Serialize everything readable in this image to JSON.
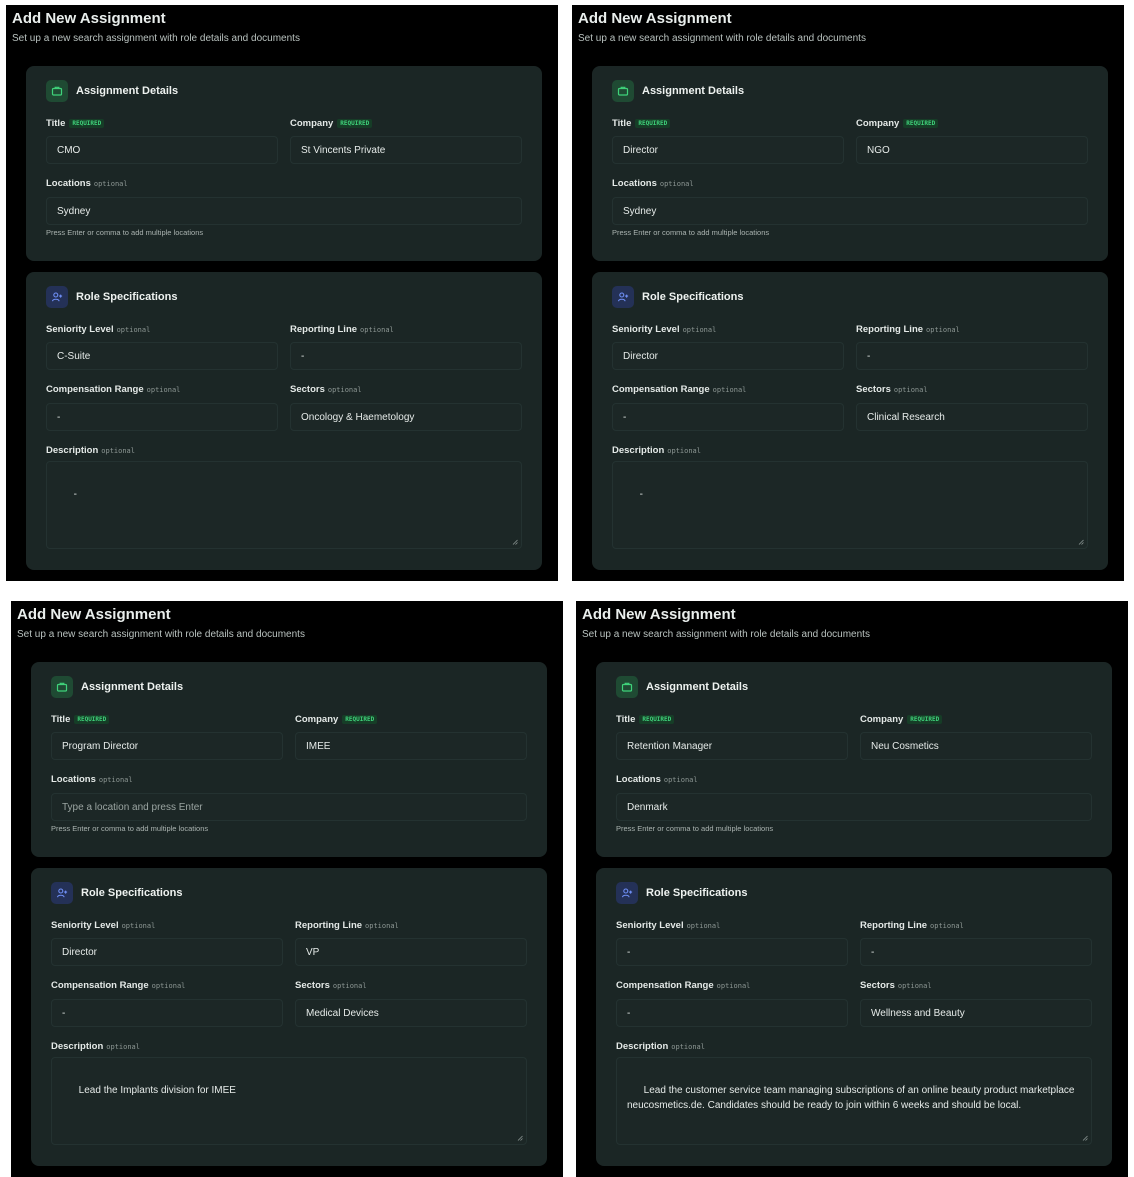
{
  "screens": [
    {
      "title": "Add New Assignment",
      "subtitle": "Set up a new search assignment with role details and documents",
      "details": {
        "heading": "Assignment Details",
        "title_label": "Title",
        "title_badge": "REQUIRED",
        "title_value": "CMO",
        "company_label": "Company",
        "company_badge": "REQUIRED",
        "company_value": "St Vincents Private",
        "locations_label": "Locations",
        "locations_note": "optional",
        "locations_value": "Sydney",
        "hint": "Press Enter or comma to add multiple locations"
      },
      "roles": {
        "heading": "Role Specifications",
        "seniority_label": "Seniority Level",
        "seniority_note": "optional",
        "seniority_value": "C-Suite",
        "reporting_label": "Reporting Line",
        "reporting_note": "optional",
        "reporting_value": "-",
        "comp_label": "Compensation Range",
        "comp_note": "optional",
        "comp_value": "-",
        "sectors_label": "Sectors",
        "sectors_note": "optional",
        "sectors_value": "Oncology & Haemetology",
        "desc_label": "Description",
        "desc_note": "optional",
        "desc_value": "-"
      }
    },
    {
      "title": "Add New Assignment",
      "subtitle": "Set up a new search assignment with role details and documents",
      "details": {
        "heading": "Assignment Details",
        "title_label": "Title",
        "title_badge": "REQUIRED",
        "title_value": "Director",
        "company_label": "Company",
        "company_badge": "REQUIRED",
        "company_value": "NGO",
        "locations_label": "Locations",
        "locations_note": "optional",
        "locations_value": "Sydney",
        "hint": "Press Enter or comma to add multiple locations"
      },
      "roles": {
        "heading": "Role Specifications",
        "seniority_label": "Seniority Level",
        "seniority_note": "optional",
        "seniority_value": "Director",
        "reporting_label": "Reporting Line",
        "reporting_note": "optional",
        "reporting_value": "-",
        "comp_label": "Compensation Range",
        "comp_note": "optional",
        "comp_value": "-",
        "sectors_label": "Sectors",
        "sectors_note": "optional",
        "sectors_value": "Clinical Research",
        "desc_label": "Description",
        "desc_note": "optional",
        "desc_value": "-"
      }
    },
    {
      "title": "Add New Assignment",
      "subtitle": "Set up a new search assignment with role details and documents",
      "details": {
        "heading": "Assignment Details",
        "title_label": "Title",
        "title_badge": "REQUIRED",
        "title_value": "Program Director",
        "company_label": "Company",
        "company_badge": "REQUIRED",
        "company_value": "IMEE",
        "locations_label": "Locations",
        "locations_note": "optional",
        "locations_value": "",
        "locations_placeholder": "Type a location and press Enter",
        "hint": "Press Enter or comma to add multiple locations"
      },
      "roles": {
        "heading": "Role Specifications",
        "seniority_label": "Seniority Level",
        "seniority_note": "optional",
        "seniority_value": "Director",
        "reporting_label": "Reporting Line",
        "reporting_note": "optional",
        "reporting_value": "VP",
        "comp_label": "Compensation Range",
        "comp_note": "optional",
        "comp_value": "-",
        "sectors_label": "Sectors",
        "sectors_note": "optional",
        "sectors_value": "Medical Devices",
        "desc_label": "Description",
        "desc_note": "optional",
        "desc_value": "Lead the Implants division for IMEE"
      }
    },
    {
      "title": "Add New Assignment",
      "subtitle": "Set up a new search assignment with role details and documents",
      "details": {
        "heading": "Assignment Details",
        "title_label": "Title",
        "title_badge": "REQUIRED",
        "title_value": "Retention Manager",
        "company_label": "Company",
        "company_badge": "REQUIRED",
        "company_value": "Neu Cosmetics",
        "locations_label": "Locations",
        "locations_note": "optional",
        "locations_value": "Denmark",
        "hint": "Press Enter or comma to add multiple locations"
      },
      "roles": {
        "heading": "Role Specifications",
        "seniority_label": "Seniority Level",
        "seniority_note": "optional",
        "seniority_value": "-",
        "reporting_label": "Reporting Line",
        "reporting_note": "optional",
        "reporting_value": "-",
        "comp_label": "Compensation Range",
        "comp_note": "optional",
        "comp_value": "-",
        "sectors_label": "Sectors",
        "sectors_note": "optional",
        "sectors_value": "Wellness and Beauty",
        "desc_label": "Description",
        "desc_note": "optional",
        "desc_value": "Lead the customer service team managing subscriptions of an online beauty product marketplace neucosmetics.de. Candidates should be ready to join within 6 weeks and should be local."
      }
    }
  ],
  "colors": {
    "page_bg": "#000000",
    "card_bg": "#1b2625",
    "required_badge_bg": "#163d27",
    "required_badge_text": "#3fd27a",
    "details_icon_accent": "#3fd27a",
    "roles_icon_accent": "#6f8ff5"
  },
  "icons": {
    "details": "briefcase-icon",
    "roles": "user-plus-icon",
    "resize": "resize-grip-icon"
  }
}
